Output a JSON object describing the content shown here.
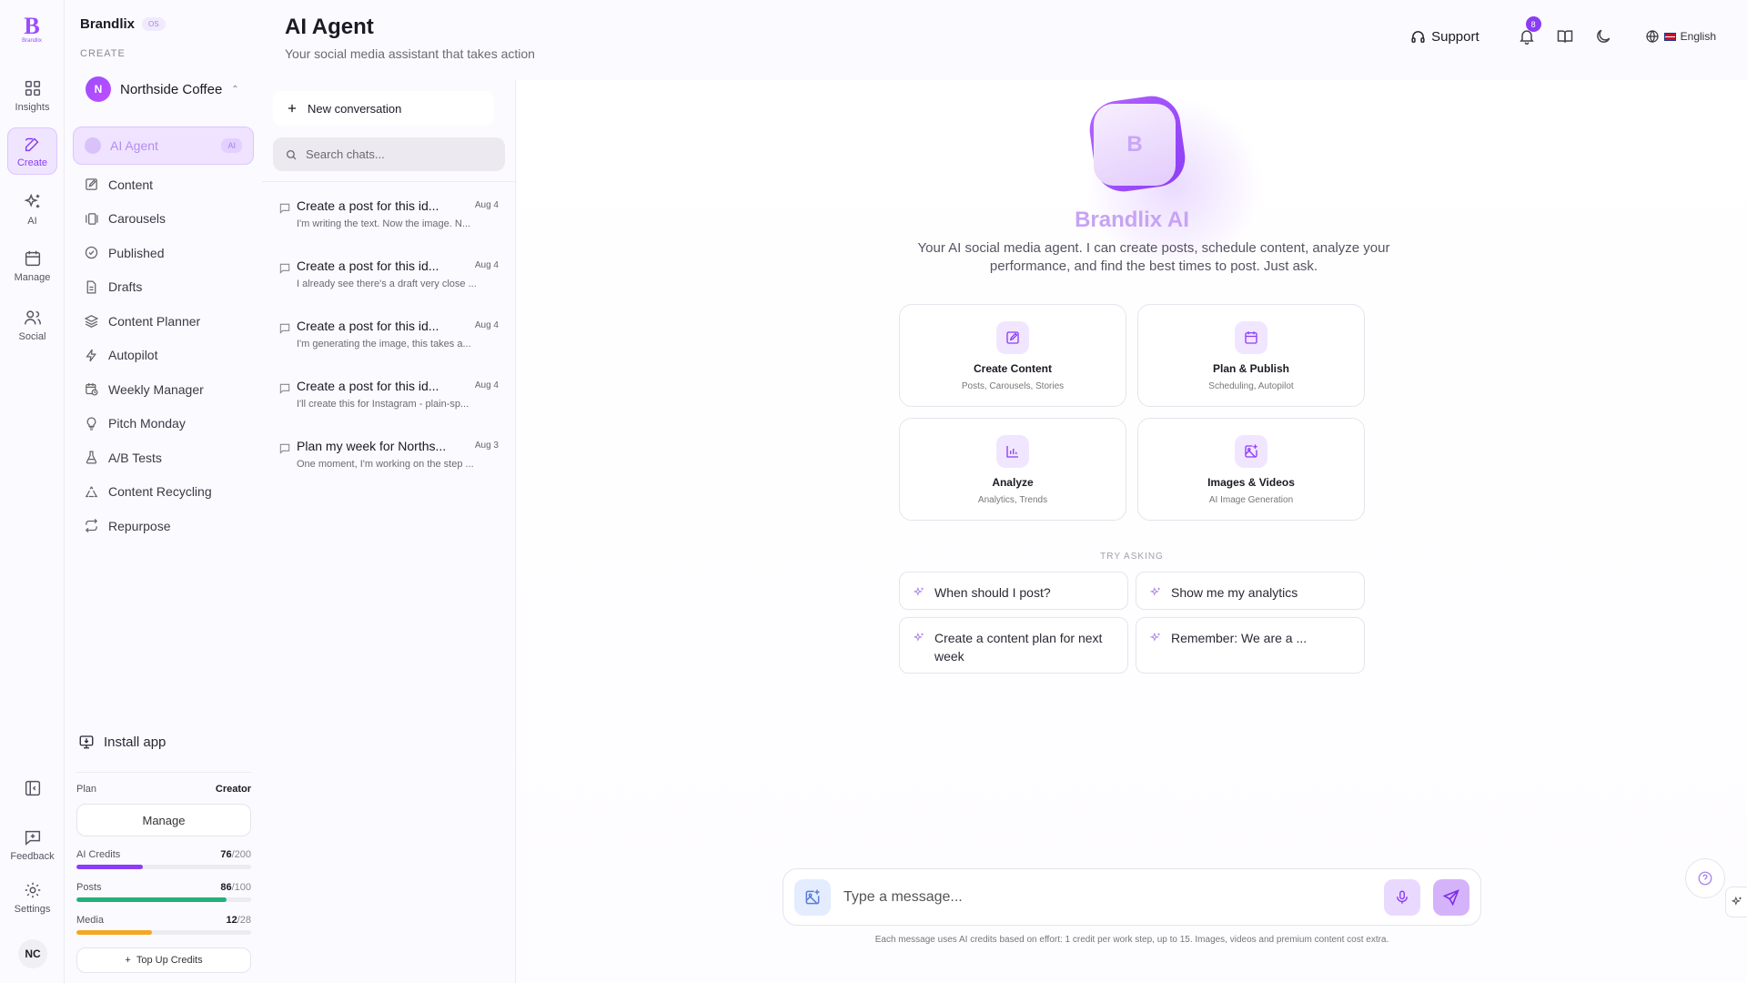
{
  "rail": {
    "logo_text": "Brandlix",
    "items": [
      {
        "label": "Insights",
        "icon": "grid-icon"
      },
      {
        "label": "Create",
        "icon": "edit-icon"
      },
      {
        "label": "AI",
        "icon": "sparkles-icon"
      },
      {
        "label": "Manage",
        "icon": "calendar-icon"
      },
      {
        "label": "Social",
        "icon": "users-icon"
      }
    ],
    "feedback_label": "Feedback",
    "settings_label": "Settings",
    "user_initials": "NC"
  },
  "sidebar": {
    "brand": "Brandlix",
    "brand_badge": "OS",
    "section_label": "CREATE",
    "workspace_initial": "N",
    "workspace_name": "Northside Coffee",
    "items": [
      {
        "label": "AI Agent",
        "badge": "AI",
        "icon": "dot"
      },
      {
        "label": "Content",
        "icon": "edit-icon"
      },
      {
        "label": "Carousels",
        "icon": "carousel-icon"
      },
      {
        "label": "Published",
        "icon": "check-circle-icon"
      },
      {
        "label": "Drafts",
        "icon": "file-icon"
      },
      {
        "label": "Content Planner",
        "icon": "layers-icon"
      },
      {
        "label": "Autopilot",
        "icon": "zap-icon"
      },
      {
        "label": "Weekly Manager",
        "icon": "calendar-clock-icon"
      },
      {
        "label": "Pitch Monday",
        "icon": "lightbulb-icon"
      },
      {
        "label": "A/B Tests",
        "icon": "flask-icon"
      },
      {
        "label": "Content Recycling",
        "icon": "recycle-icon"
      },
      {
        "label": "Repurpose",
        "icon": "repeat-icon"
      }
    ],
    "install_label": "Install app",
    "plan": {
      "label": "Plan",
      "value": "Creator",
      "manage_label": "Manage",
      "meters": [
        {
          "label": "AI Credits",
          "used": "76",
          "total": "/200",
          "fraction": 0.38,
          "color": "#8b3df5"
        },
        {
          "label": "Posts",
          "used": "86",
          "total": "/100",
          "fraction": 0.86,
          "color": "#22b07d"
        },
        {
          "label": "Media",
          "used": "12",
          "total": "/28",
          "fraction": 0.43,
          "color": "#f5a623"
        }
      ],
      "topup_label": "Top Up Credits"
    }
  },
  "header": {
    "title": "AI Agent",
    "subtitle": "Your social media assistant that takes action",
    "support_label": "Support",
    "notification_count": "8",
    "language": "English"
  },
  "conversations": {
    "new_label": "New conversation",
    "search_placeholder": "Search chats...",
    "items": [
      {
        "title": "Create a post for this id...",
        "date": "Aug 4",
        "preview": "I'm writing the text. Now the image. N..."
      },
      {
        "title": "Create a post for this id...",
        "date": "Aug 4",
        "preview": "I already see there's a draft very close ..."
      },
      {
        "title": "Create a post for this id...",
        "date": "Aug 4",
        "preview": "I'm generating the image, this takes a..."
      },
      {
        "title": "Create a post for this id...",
        "date": "Aug 4",
        "preview": "I'll create this for Instagram - plain-sp..."
      },
      {
        "title": "Plan my week for Norths...",
        "date": "Aug 3",
        "preview": "One moment, I'm working on the step ..."
      }
    ]
  },
  "main": {
    "hero_letter": "B",
    "hero_title": "Brandlix AI",
    "hero_desc": "Your AI social media agent. I can create posts, schedule content, analyze your performance, and find the best times to post. Just ask.",
    "cards": [
      {
        "title": "Create Content",
        "subtitle": "Posts, Carousels, Stories",
        "icon": "edit-icon"
      },
      {
        "title": "Plan & Publish",
        "subtitle": "Scheduling, Autopilot",
        "icon": "calendar-icon"
      },
      {
        "title": "Analyze",
        "subtitle": "Analytics, Trends",
        "icon": "bar-chart-icon"
      },
      {
        "title": "Images & Videos",
        "subtitle": "AI Image Generation",
        "icon": "image-plus-icon"
      }
    ],
    "try_label": "TRY ASKING",
    "suggestions": [
      "When should I post?",
      "Show me my analytics",
      "Create a content plan for next week",
      "Remember: We are a ..."
    ],
    "composer_placeholder": "Type a message...",
    "footnote": "Each message uses AI credits based on effort: 1 credit per work step, up to 15. Images, videos and premium content cost extra."
  }
}
